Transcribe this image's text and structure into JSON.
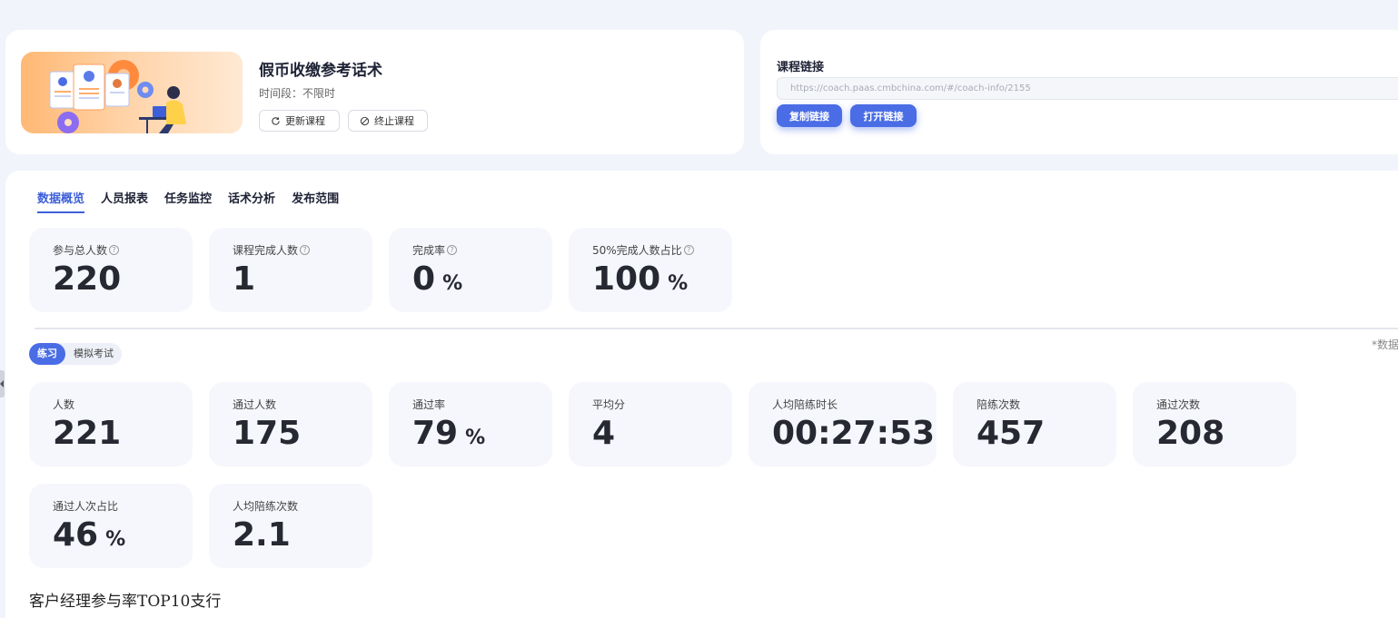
{
  "course": {
    "title": "假币收缴参考话术",
    "period": "时间段：不限时",
    "update_label": "更新课程",
    "stop_label": "终止课程"
  },
  "link": {
    "label": "课程链接",
    "url": "https://coach.paas.cmbchina.com/#/coach-info/2155",
    "copy_label": "复制链接",
    "open_label": "打开链接"
  },
  "tabs": [
    {
      "label": "数据概览",
      "active": true
    },
    {
      "label": "人员报表"
    },
    {
      "label": "任务监控"
    },
    {
      "label": "话术分析"
    },
    {
      "label": "发布范围"
    }
  ],
  "overview": [
    {
      "label": "参与总人数",
      "value": "220",
      "unit": ""
    },
    {
      "label": "课程完成人数",
      "value": "1",
      "unit": ""
    },
    {
      "label": "完成率",
      "value": "0",
      "unit": "%"
    },
    {
      "label": "50%完成人数占比",
      "value": "100",
      "unit": "%"
    }
  ],
  "note": "*数据",
  "mode": {
    "options": [
      "练习",
      "模拟考试"
    ],
    "selected": "练习"
  },
  "practice_stats": [
    {
      "label": "人数",
      "value": "221",
      "unit": ""
    },
    {
      "label": "通过人数",
      "value": "175",
      "unit": ""
    },
    {
      "label": "通过率",
      "value": "79",
      "unit": "%"
    },
    {
      "label": "平均分",
      "value": "4",
      "unit": ""
    },
    {
      "label": "人均陪练时长",
      "value": "00:27:53",
      "unit": ""
    },
    {
      "label": "陪练次数",
      "value": "457",
      "unit": ""
    },
    {
      "label": "通过次数",
      "value": "208",
      "unit": ""
    },
    {
      "label": "通过人次占比",
      "value": "46",
      "unit": "%"
    },
    {
      "label": "人均陪练次数",
      "value": "2.1",
      "unit": ""
    }
  ],
  "section_title": "客户经理参与率TOP10支行",
  "colors": {
    "accent": "#4a6de5",
    "tab_active": "#3d5fd9",
    "stat_bg": "#f6f7fc",
    "page_bg": "#f2f4fb"
  }
}
